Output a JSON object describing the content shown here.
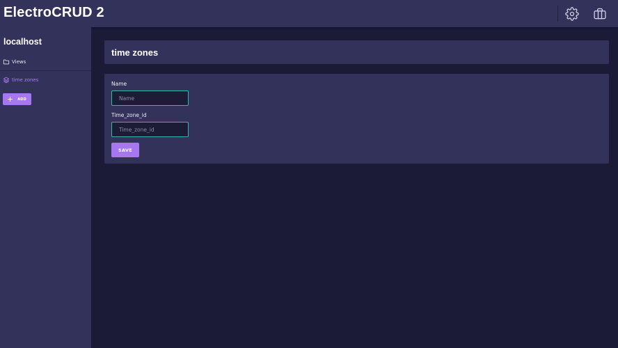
{
  "app": {
    "title": "ElectroCRUD 2"
  },
  "toolbar": {
    "settings_icon": "gear-icon",
    "workspaces_icon": "briefcase-icon"
  },
  "sidebar": {
    "host": "localhost",
    "items": [
      {
        "label": "Views",
        "icon": "folder-icon",
        "active": false
      },
      {
        "label": "time zones",
        "icon": "layers-icon",
        "active": true
      }
    ],
    "add_button": {
      "label": "ADD",
      "icon": "plus-icon"
    }
  },
  "main": {
    "title": "time zones",
    "form": {
      "fields": [
        {
          "label": "Name",
          "placeholder": "Name",
          "value": ""
        },
        {
          "label": "Time_zone_id",
          "placeholder": "Time_zone_id",
          "value": ""
        }
      ],
      "save_label": "SAVE"
    }
  },
  "colors": {
    "accent": "#a777f1",
    "input_border": "#35b8a9",
    "panel": "#33325a",
    "background": "#1b1b38"
  }
}
